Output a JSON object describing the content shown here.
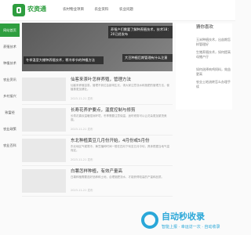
{
  "brand": {
    "name": "农资通"
  },
  "nav": [
    "农村物业项目",
    "农业资料",
    "农业问题"
  ],
  "leftnav": [
    "网站首页",
    "养殖技术",
    "种植技术",
    "农业资讯",
    "乡村振兴",
    "致富经",
    "农业政策",
    "农业百科"
  ],
  "hero": {
    "banner1": "养殖户们需要了解种养殖技术，技术18：20已经发布",
    "banner2": "大豆种植后期管理有什么注意",
    "banner3": "冬季温室大棚种养殖技术，寒冷季节的种植方法"
  },
  "sidebar": {
    "title": "猜你喜欢",
    "items": [
      "玉米种植技术，出苗期怎样管理好",
      "生猪养殖技术，如何提高母猪产仔",
      "如何选择肉鸡饲料，效益更高",
      "农业土地流转怎么办理手续"
    ]
  },
  "articles": [
    {
      "title": "仙客来茶叶怎样养殖，管理方法",
      "summary": "仙客来养殖容易，管理不到位会影响生长，请大家注意浇水和施肥的管理方法，使植株更加健壮。",
      "meta": "2023-11-21 发布"
    },
    {
      "title": "长寿花养护要点，温度控制与修剪",
      "summary": "长寿花喜欢温暖湿润环境，冬季需要注意保温，适时修剪可以让花朵更加繁茂美观。",
      "meta": "2023-11-21 发布"
    },
    {
      "title": "东北种植黄豆几月份开始，4月份或5月份",
      "summary": "东北地区气候寒冷，黄豆播种时间一般在四月下旬至五月中旬，具体根据当地气温而定。",
      "meta": "2023-11-21 发布"
    },
    {
      "title": "白薯怎样种植，有效产量高",
      "summary": "白薯种植需要选好品种和土地，合理施肥浇水，才能获得较高的产量和品质。",
      "meta": "2023-11-21 发布"
    }
  ],
  "watermark": {
    "main": "自动秒收录",
    "sub": "智能上报 · 幸运访一次 · 自动收录"
  }
}
